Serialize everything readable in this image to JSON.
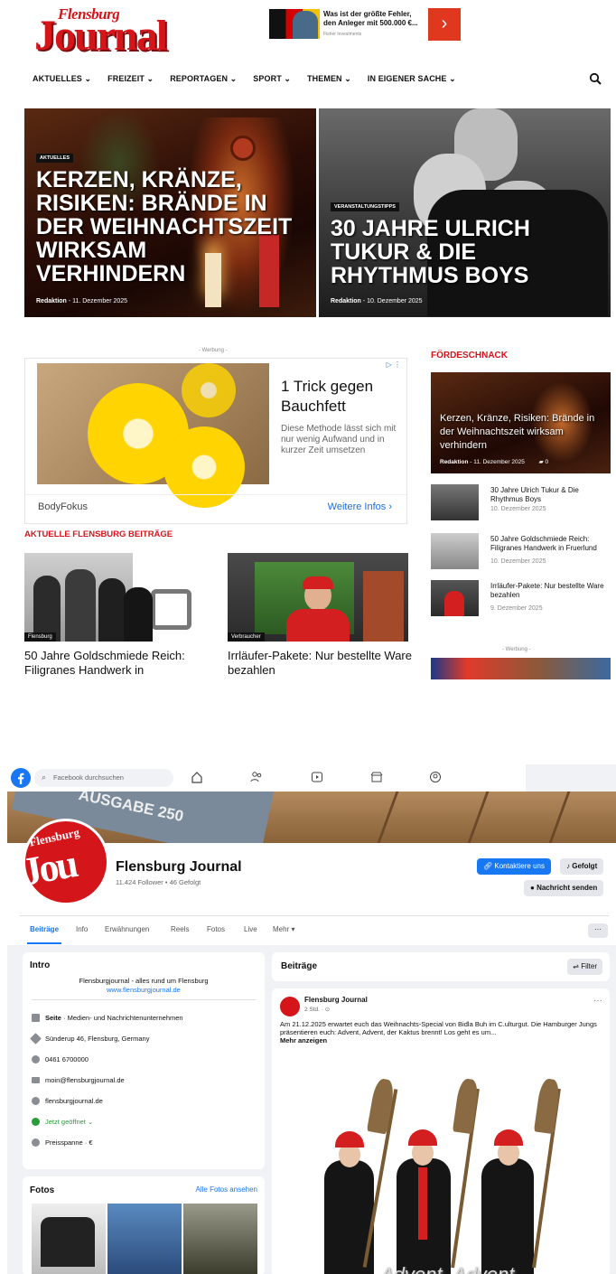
{
  "site": {
    "logo": {
      "small": "Flensburg",
      "big": "Journal"
    },
    "top_ad": {
      "text": "Was ist der größte Fehler, den Anleger mit 500.000 €...",
      "source": "Fisher Investments",
      "arrow": "›"
    },
    "nav": [
      "AKTUELLES ⌄",
      "FREIZEIT ⌄",
      "REPORTAGEN ⌄",
      "SPORT ⌄",
      "THEMEN ⌄",
      "IN EIGENER SACHE ⌄"
    ],
    "hero": [
      {
        "category": "AKTUELLES",
        "title": "Kerzen, Kränze, Risiken: Brände in der Weihnachtszeit wirksam verhindern",
        "author": "Redaktion",
        "date": "- 11. Dezember 2025"
      },
      {
        "category": "VERANSTALTUNGSTIPPS",
        "title": "30 Jahre Ulrich Tukur & die Rhythmus Boys",
        "author": "Redaktion",
        "date": "- 10. Dezember 2025"
      }
    ],
    "werbung": "- Werbung -",
    "ad": {
      "headline": "1 Trick gegen Bauchfett",
      "desc": "Diese Methode lässt sich mit nur wenig Aufwand und in kurzer Zeit umsetzen",
      "source": "BodyFokus",
      "cta": "Weitere Infos ›"
    },
    "section_title": "AKTUELLE FLENSBURG BEITRÄGE",
    "cards": [
      {
        "category": "Flensburg",
        "title": "50 Jahre Goldschmiede Reich: Filigranes Handwerk in"
      },
      {
        "category": "Verbraucher",
        "title": "Irrläufer-Pakete: Nur bestellte Ware bezahlen"
      }
    ],
    "sidebar": {
      "title": "FÖRDESCHNACK",
      "featured": {
        "title": "Kerzen, Kränze, Risiken: Brände in der Weihnachtszeit wirksam verhindern",
        "author": "Redaktion",
        "date": "- 11. Dezember 2025",
        "comments": "0"
      },
      "items": [
        {
          "title": "30 Jahre Ulrich Tukur & Die Rhythmus Boys",
          "date": "10. Dezember 2025"
        },
        {
          "title": "50 Jahre Goldschmiede Reich: Filigranes Handwerk in Fruerlund",
          "date": "10. Dezember 2025"
        },
        {
          "title": "Irrläufer-Pakete: Nur bestellte Ware bezahlen",
          "date": "9. Dezember 2025"
        }
      ],
      "werbung": "- Werbung -"
    }
  },
  "fb": {
    "search_placeholder": "Facebook durchsuchen",
    "cover_text": "AUSGABE 250",
    "page_name": "Flensburg Journal",
    "stats": "11.424 Follower • 46 Gefolgt",
    "btn_contact": "Kontaktiere uns",
    "btn_follow": "Gefolgt",
    "btn_message": "Nachricht senden",
    "tabs": [
      "Beiträge",
      "Info",
      "Erwähnungen",
      "Reels",
      "Fotos",
      "Live",
      "Mehr ▾"
    ],
    "more_btn": "···",
    "intro": {
      "title": "Intro",
      "bio": "Flensburgjournal - alles rund um Flensburg",
      "link": "www.flensburgjournal.de",
      "rows": [
        {
          "bold": "Seite",
          "text": " · Medien- und Nachrichtenunternehmen"
        },
        {
          "bold": "",
          "text": "Sünderup 46, Flensburg, Germany"
        },
        {
          "bold": "",
          "text": "0461 6700000"
        },
        {
          "bold": "",
          "text": "moin@flensburgjournal.de"
        },
        {
          "bold": "",
          "text": "flensburgjournal.de"
        },
        {
          "bold": "",
          "text": "Jetzt geöffnet ⌄"
        },
        {
          "bold": "",
          "text": "Preisspanne · €"
        }
      ]
    },
    "fotos": {
      "title": "Fotos",
      "all": "Alle Fotos ansehen"
    },
    "posts": {
      "title": "Beiträge",
      "filter": "Filter",
      "author": "Flensburg Journal",
      "time": "2 Std. · ⊙",
      "text": "Am 21.12.2025 erwartet euch das Weihnachts-Special von Bidla Buh im C.ulturgut. Die Hamburger Jungs präsentieren euch: Advent, Advent, der Kaktus brennt! Los geht es um...",
      "more": "Mehr anzeigen",
      "overlay": "Advent, Advent,"
    }
  }
}
